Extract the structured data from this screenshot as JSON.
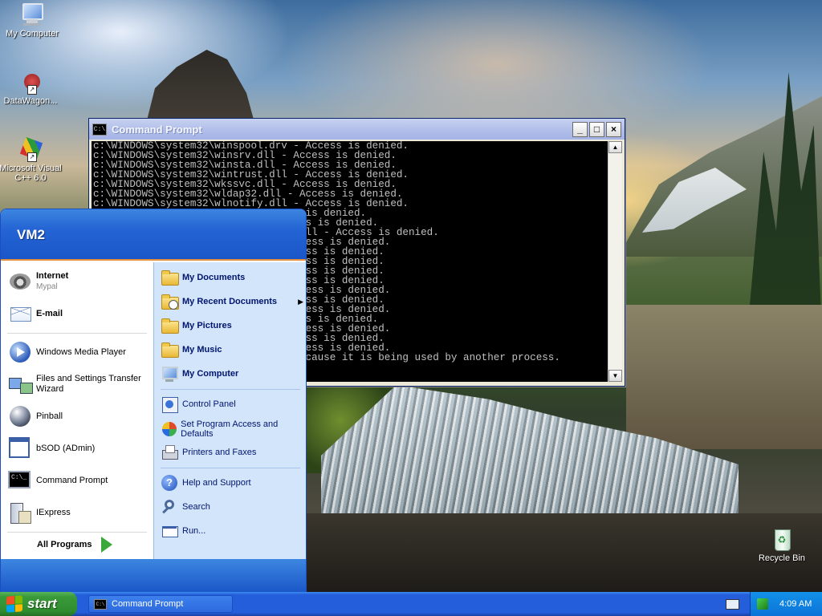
{
  "desktop": {
    "icons": [
      {
        "label": "My Computer"
      },
      {
        "label": "DataWagon..."
      },
      {
        "label": "Microsoft Visual C++ 6.0"
      },
      {
        "label": "Recycle Bin"
      }
    ]
  },
  "cmd_window": {
    "title": "Command Prompt",
    "buttons": {
      "minimize": "_",
      "maximize": "□",
      "close": "×"
    },
    "icon_text": "C:\\",
    "lines": [
      "c:\\WINDOWS\\system32\\winspool.drv - Access is denied.",
      "c:\\WINDOWS\\system32\\winsrv.dll - Access is denied.",
      "c:\\WINDOWS\\system32\\winsta.dll - Access is denied.",
      "c:\\WINDOWS\\system32\\wintrust.dll - Access is denied.",
      "c:\\WINDOWS\\system32\\wkssvc.dll - Access is denied.",
      "c:\\WINDOWS\\system32\\wldap32.dll - Access is denied.",
      "c:\\WINDOWS\\system32\\wlnotify.dll - Access is denied.",
      "                               ess is denied.",
      "                               ccess is denied.",
      "                               bj.dll - Access is denied.",
      "                                Access is denied.",
      "                               Access is denied.",
      "                               Access is denied.",
      "                               Access is denied.",
      "                               Access is denied.",
      "                                Access is denied.",
      "                               Access is denied.",
      "                                Access is denied.",
      "                               ccess is denied.",
      "                                Access is denied.",
      "                               Access is denied.",
      "                                Access is denied.",
      "                               e because it is being used by another process."
    ]
  },
  "start_menu": {
    "user": "VM2",
    "pinned": [
      {
        "title": "Internet",
        "subtitle": "Mypal"
      },
      {
        "title": "E-mail"
      }
    ],
    "recent": [
      "Windows Media Player",
      "Files and Settings Transfer Wizard",
      "Pinball",
      "bSOD (ADmin)",
      "Command Prompt",
      "IExpress"
    ],
    "all_programs": "All Programs",
    "right": [
      "My Documents",
      "My Recent Documents",
      "My Pictures",
      "My Music",
      "My Computer",
      "Control Panel",
      "Set Program Access and Defaults",
      "Printers and Faxes",
      "Help and Support",
      "Search",
      "Run..."
    ]
  },
  "taskbar": {
    "start_label": "start",
    "active_task": "Command Prompt",
    "clock": "4:09 AM"
  },
  "colors": {
    "xp_blue": "#245edb",
    "start_green": "#3a9a3a",
    "console_bg": "#000000",
    "console_text": "#c0c0c0"
  }
}
